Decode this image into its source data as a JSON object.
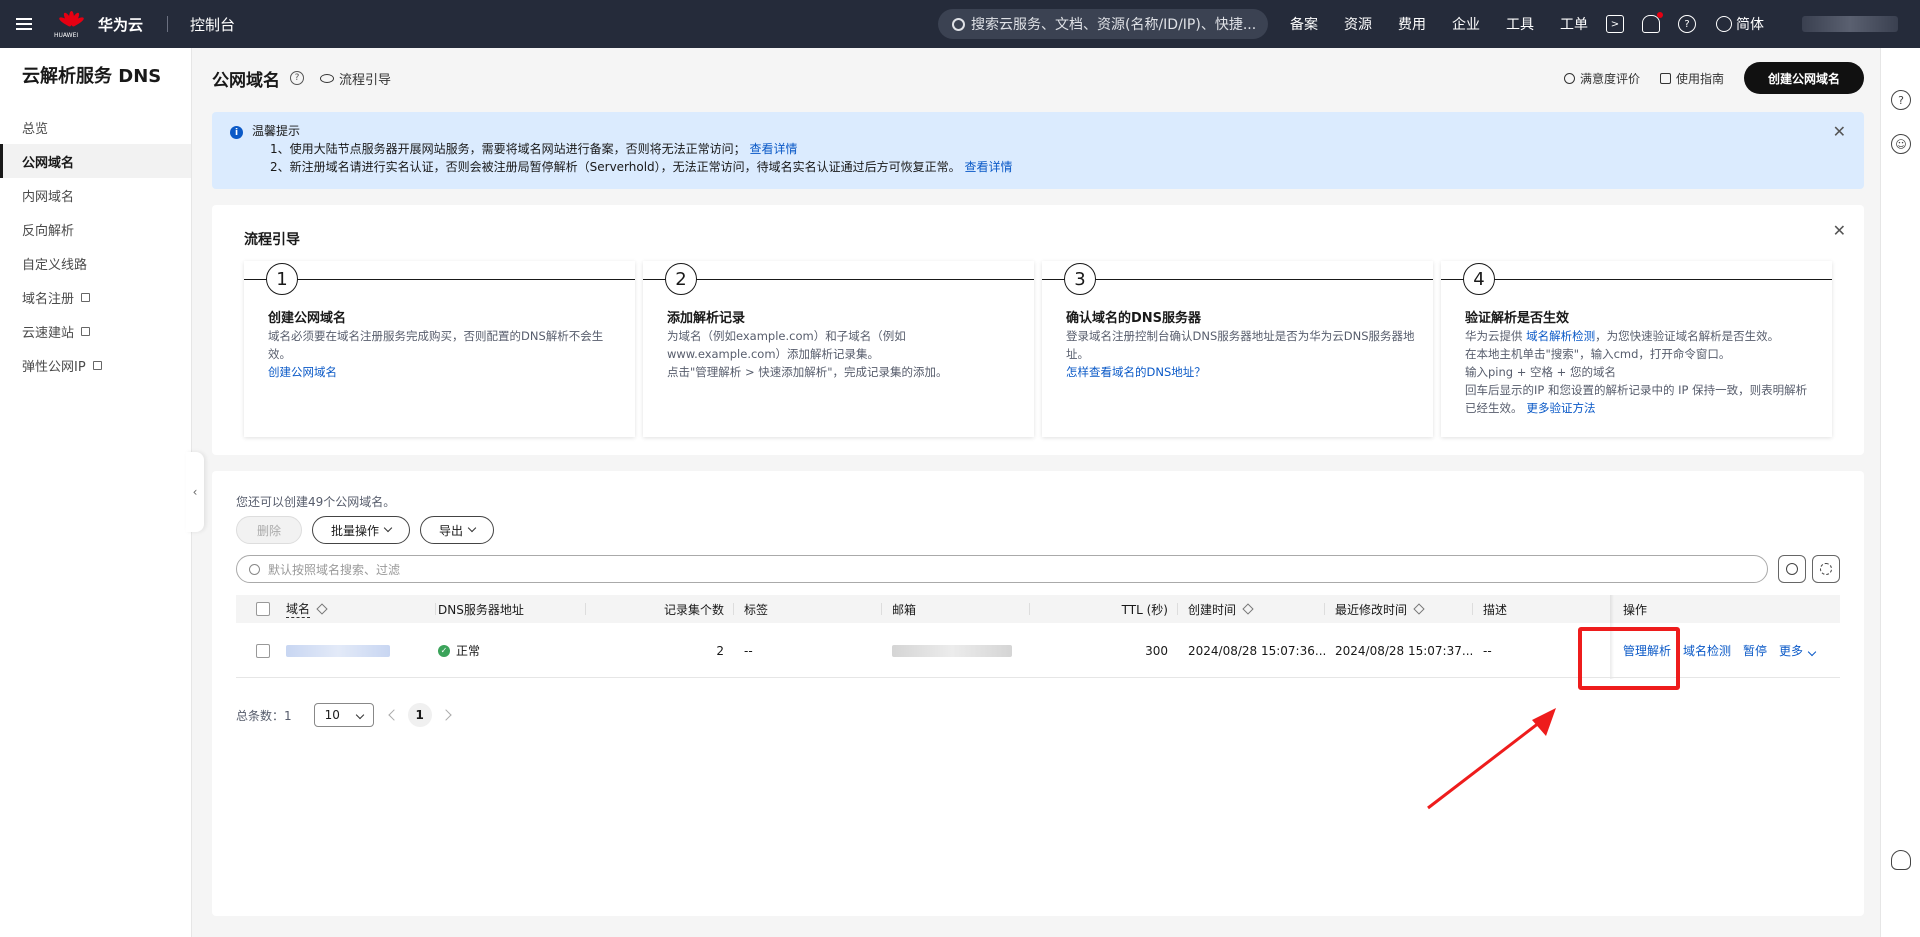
{
  "topbar": {
    "brand_sub": "HUAWEI",
    "brand_name": "华为云",
    "console": "控制台",
    "search_placeholder": "搜索云服务、文档、资源(名称/ID/IP)、快捷...",
    "links": [
      "备案",
      "资源",
      "费用",
      "企业",
      "工具",
      "工单"
    ],
    "lang": "简体"
  },
  "sidebar": {
    "title": "云解析服务 DNS",
    "items": [
      {
        "label": "总览"
      },
      {
        "label": "公网域名",
        "active": true
      },
      {
        "label": "内网域名"
      },
      {
        "label": "反向解析"
      },
      {
        "label": "自定义线路"
      },
      {
        "label": "域名注册",
        "external": true
      },
      {
        "label": "云速建站",
        "external": true
      },
      {
        "label": "弹性公网IP",
        "external": true
      }
    ]
  },
  "header": {
    "title": "公网域名",
    "flow_link": "流程引导",
    "satisfaction": "满意度评价",
    "guide": "使用指南",
    "create_button": "创建公网域名"
  },
  "notice": {
    "title": "温馨提示",
    "line1": "1、使用大陆节点服务器开展网站服务，需要将域名网站进行备案，否则将无法正常访问；",
    "line1_link": "查看详情",
    "line2": "2、新注册域名请进行实名认证，否则会被注册局暂停解析（Serverhold），无法正常访问，待域名实名认证通过后方可恢复正常。",
    "line2_link": "查看详情"
  },
  "flow": {
    "title": "流程引导",
    "steps": [
      {
        "num": "1",
        "title": "创建公网域名",
        "desc": "域名必须要在域名注册服务完成购买，否则配置的DNS解析不会生效。",
        "link": "创建公网域名"
      },
      {
        "num": "2",
        "title": "添加解析记录",
        "desc": "为域名（例如example.com）和子域名（例如www.example.com）添加解析记录集。",
        "desc2": "点击\"管理解析 > 快速添加解析\"，完成记录集的添加。"
      },
      {
        "num": "3",
        "title": "确认域名的DNS服务器",
        "desc": "登录域名注册控制台确认DNS服务器地址是否为华为云DNS服务器地址。",
        "link": "怎样查看域名的DNS地址？"
      },
      {
        "num": "4",
        "title": "验证解析是否生效",
        "desc_pre": "华为云提供 ",
        "desc_link": "域名解析检测",
        "desc_post": "，为您快速验证域名解析是否生效。",
        "desc2": "在本地主机单击\"搜索\"，输入cmd，打开命令窗口。",
        "desc3": "输入ping + 空格 + 您的域名",
        "desc4": "回车后显示的IP 和您设置的解析记录中的 IP 保持一致，则表明解析已经生效。",
        "link": "更多验证方法"
      }
    ]
  },
  "table": {
    "quota": "您还可以创建49个公网域名。",
    "delete_btn": "删除",
    "batch_btn": "批量操作",
    "export_btn": "导出",
    "search_placeholder": "默认按照域名搜索、过滤",
    "columns": [
      "域名",
      "DNS服务器地址",
      "记录集个数",
      "标签",
      "邮箱",
      "TTL (秒)",
      "创建时间",
      "最近修改时间",
      "描述",
      "操作"
    ],
    "rows": [
      {
        "status": "正常",
        "record_count": "2",
        "tags": "--",
        "ttl": "300",
        "created": "2024/08/28 15:07:36...",
        "modified": "2024/08/28 15:07:37...",
        "desc": "--",
        "actions": [
          "管理解析",
          "域名检测",
          "暂停",
          "更多"
        ]
      }
    ],
    "total_label": "总条数：1",
    "page_size": "10",
    "current_page": "1"
  },
  "colors": {
    "topbar_bg": "#252b3a",
    "link": "#0a59c7",
    "notice_bg": "#dbebfe",
    "annotation_red": "#ee1c1c",
    "status_green": "#3ba35a"
  }
}
